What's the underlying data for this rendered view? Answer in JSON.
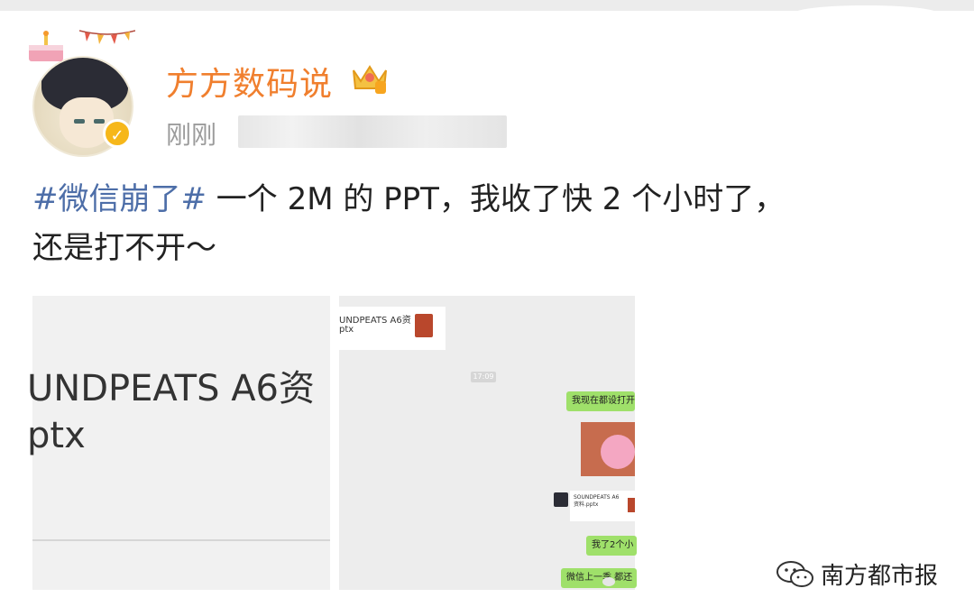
{
  "post": {
    "username": "方方数码说",
    "time": "刚刚",
    "hashtag": "#微信崩了#",
    "body_line1": " 一个 2M 的 PPT，我收了快 2 个小时了，",
    "body_line2": "还是打不开～"
  },
  "image1": {
    "file_name": "UNDPEATS A6资",
    "file_ext": "ptx"
  },
  "image2": {
    "file_name": "UNDPEATS A6资",
    "file_ext": "ptx",
    "chat_time": "17:09",
    "bubble1": "我现在都设打开吗",
    "file_card_text": "SOUNDPEATS A6资料.pptx",
    "bubble2": "我了2个小",
    "bubble3": "微信上一季 都还"
  },
  "watermark": {
    "text": "南方都市报"
  },
  "colors": {
    "username": "#f07f2e",
    "hashtag": "#4d6ea8",
    "verified": "#f6b71a",
    "bubble": "#9fe06a"
  },
  "icons": [
    "birthday-cake-icon",
    "bunting-icon",
    "verified-icon",
    "crown-badge-icon",
    "pptx-file-icon",
    "wechat-icon"
  ]
}
